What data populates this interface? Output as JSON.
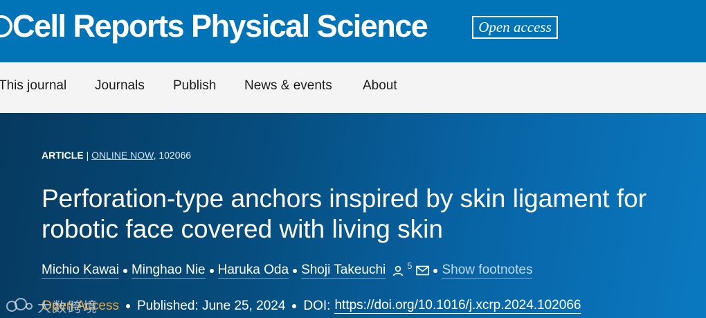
{
  "header": {
    "journal_title": "Cell Reports Physical Science",
    "open_access_badge": "Open access",
    "brand_color": "#0074b7"
  },
  "nav": {
    "items": [
      {
        "label": "This journal"
      },
      {
        "label": "Journals"
      },
      {
        "label": "Publish"
      },
      {
        "label": "News & events"
      },
      {
        "label": "About"
      }
    ]
  },
  "article": {
    "type": "ARTICLE",
    "separator": "|",
    "status": "ONLINE NOW",
    "article_number": ", 102066",
    "title": "Perforation-type anchors inspired by skin ligament for robotic face covered with living skin",
    "authors": [
      "Michio Kawai",
      "Minghao Nie",
      "Haruka Oda",
      "Shoji Takeuchi"
    ],
    "author_icons": [
      "person-icon",
      "envelope-icon"
    ],
    "corresponding_count": "5",
    "show_footnotes": "Show footnotes",
    "open_access_label": "Open Access",
    "published": "Published: June 25, 2024",
    "doi_label": "DOI:",
    "doi": "https://doi.org/10.1016/j.xcrp.2024.102066"
  },
  "watermark": {
    "text": "大数跨境"
  }
}
